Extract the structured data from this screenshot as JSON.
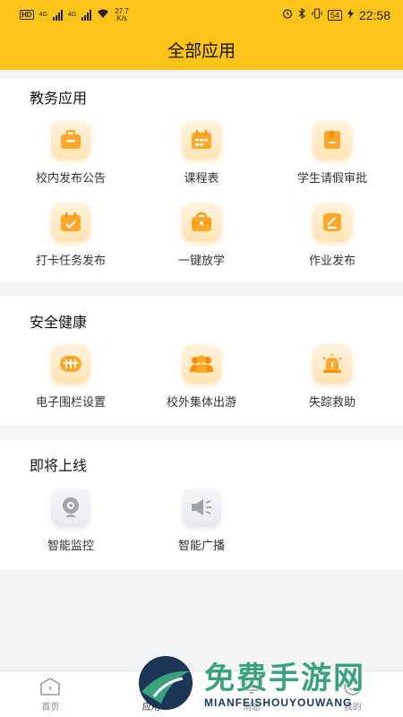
{
  "status_bar": {
    "hd": "HD",
    "net1": "4G",
    "net2": "4G",
    "speed_value": "27.7",
    "speed_unit": "K/s",
    "battery": "54",
    "time": "22:58"
  },
  "header": {
    "title": "全部应用"
  },
  "sections": [
    {
      "title": "教务应用",
      "apps": [
        {
          "label": "校内发布公告",
          "icon": "briefcase-icon"
        },
        {
          "label": "课程表",
          "icon": "calendar-grid-icon"
        },
        {
          "label": "学生请假审批",
          "icon": "leave-book-icon"
        },
        {
          "label": "打卡任务发布",
          "icon": "calendar-check-icon"
        },
        {
          "label": "一键放学",
          "icon": "school-bag-icon"
        },
        {
          "label": "作业发布",
          "icon": "homework-edit-icon"
        }
      ]
    },
    {
      "title": "安全健康",
      "apps": [
        {
          "label": "电子围栏设置",
          "icon": "fence-icon"
        },
        {
          "label": "校外集体出游",
          "icon": "group-icon"
        },
        {
          "label": "失踪救助",
          "icon": "alarm-icon"
        }
      ]
    },
    {
      "title": "即将上线",
      "apps": [
        {
          "label": "智能监控",
          "icon": "camera-icon"
        },
        {
          "label": "智能广播",
          "icon": "speaker-icon"
        }
      ]
    }
  ],
  "tabbar": {
    "tabs": [
      {
        "label": "首页"
      },
      {
        "label": "应用"
      },
      {
        "label": "消息"
      },
      {
        "label": "我的"
      }
    ]
  },
  "watermark": {
    "title": "免费手游网",
    "subtitle": "MIANFEISHOUYOUWANG"
  },
  "colors": {
    "brand_yellow": "#fcc419",
    "icon_orange": "#ffa726",
    "icon_gray": "#a0a4ab",
    "watermark_green": "#3aa17e"
  }
}
